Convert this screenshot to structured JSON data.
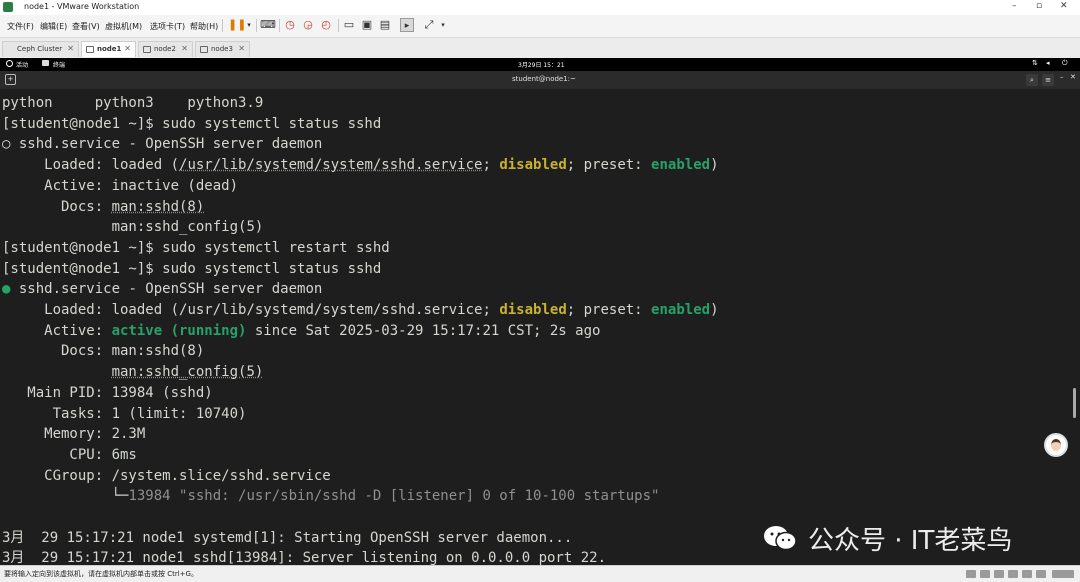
{
  "window": {
    "title": "node1 - VMware Workstation"
  },
  "menubar": {
    "items": [
      "文件(F)",
      "编辑(E)",
      "查看(V)",
      "虚拟机(M)",
      "选项卡(T)",
      "帮助(H)"
    ]
  },
  "tabs": [
    {
      "label": "Ceph Cluster",
      "active": false
    },
    {
      "label": "node1",
      "active": true
    },
    {
      "label": "node2",
      "active": false
    },
    {
      "label": "node3",
      "active": false
    }
  ],
  "gnome": {
    "activities": "活动",
    "terminal_app": "终端",
    "clock": "3月29日 15：21"
  },
  "terminal": {
    "title": "student@node1:~"
  },
  "lines": {
    "l1": "python     python3    python3.9",
    "l2": "[student@node1 ~]$ sudo systemctl status sshd",
    "l3_bullet": "○",
    "l3_text": " sshd.service - OpenSSH server daemon",
    "l4_pre": "     Loaded: loaded (",
    "l4_path": "/usr/lib/systemd/system/sshd.service",
    "l4_mid": "; ",
    "l4_disabled": "disabled",
    "l4_preset": "; preset: ",
    "l4_enabled": "enabled",
    "l4_end": ")",
    "l5": "     Active: inactive (dead)",
    "l6_pre": "       Docs: ",
    "l6_link": "man:sshd(8)",
    "l7_pre": "             ",
    "l7_link": "man:sshd_config(5)",
    "l8": "[student@node1 ~]$ sudo systemctl restart sshd",
    "l9": "[student@node1 ~]$ sudo systemctl status sshd",
    "l10_bullet": "●",
    "l10_text": " sshd.service - OpenSSH server daemon",
    "l11_pre": "     Loaded: loaded (",
    "l11_path": "/usr/lib/systemd/system/sshd.service",
    "l11_mid": "; ",
    "l11_disabled": "disabled",
    "l11_preset": "; preset: ",
    "l11_enabled": "enabled",
    "l11_end": ")",
    "l12_pre": "     Active: ",
    "l12_active": "active (running)",
    "l12_post": " since Sat 2025-03-29 15:17:21 CST; 2s ago",
    "l13": "       Docs: man:sshd(8)",
    "l14_pre": "             ",
    "l14_link": "man:sshd_config(5)",
    "l15": "   Main PID: 13984 (sshd)",
    "l16": "      Tasks: 1 (limit: 10740)",
    "l17": "     Memory: 2.3M",
    "l18": "        CPU: 6ms",
    "l19": "     CGroup: /system.slice/sshd.service",
    "l20_pre": "             └─",
    "l20_text": "13984 \"sshd: /usr/sbin/sshd -D [listener] 0 of 10-100 startups\"",
    "l21": "",
    "l22": "3月  29 15:17:21 node1 systemd[1]: Starting OpenSSH server daemon...",
    "l23": "3月  29 15:17:21 node1 sshd[13984]: Server listening on 0.0.0.0 port 22."
  },
  "watermark": {
    "text": "公众号 · IT老菜鸟"
  },
  "statusbar": {
    "text": "要将输入定向到该虚拟机，请在虚拟机内部单击或按 Ctrl+G。"
  },
  "colors": {
    "terminal_bg": "#1e1e1e",
    "green": "#26a269",
    "yellow": "#c9b22f"
  }
}
